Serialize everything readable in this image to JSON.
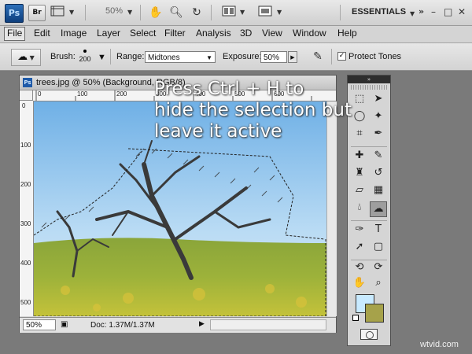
{
  "appbar": {
    "logo_text": "Ps",
    "bridge_label": "Br",
    "zoom_value": "50%",
    "workspace_label": "ESSENTIALS",
    "minimize": "–",
    "restore": "□",
    "close": "✕",
    "panel_collapse": "»"
  },
  "menu": {
    "items": [
      "File",
      "Edit",
      "Image",
      "Layer",
      "Select",
      "Filter",
      "Analysis",
      "3D",
      "View",
      "Window",
      "Help"
    ]
  },
  "options": {
    "brush_label": "Brush:",
    "brush_size": "200",
    "range_label": "Range:",
    "range_value": "Midtones",
    "exposure_label": "Exposure:",
    "exposure_value": "50%",
    "protect_tones_label": "Protect Tones",
    "protect_tones_checked": "✓"
  },
  "document": {
    "title": "trees.jpg @ 50% (Background, RGB/8)",
    "ruler_top": [
      "0",
      "100",
      "200",
      "300",
      "400",
      "500",
      "600"
    ],
    "ruler_left": [
      "0",
      "100",
      "200",
      "300",
      "400",
      "500"
    ],
    "status_zoom": "50%",
    "status_doc": "Doc: 1.37M/1.37M"
  },
  "overlay": {
    "line1": "Press Ctrl + H to",
    "line2": "hide the selection but",
    "line3": "leave it active"
  },
  "tools": {
    "header": "»",
    "foreground_color": "#c8eaff",
    "background_color": "#a6a24a"
  },
  "watermark": "wtvid.com"
}
